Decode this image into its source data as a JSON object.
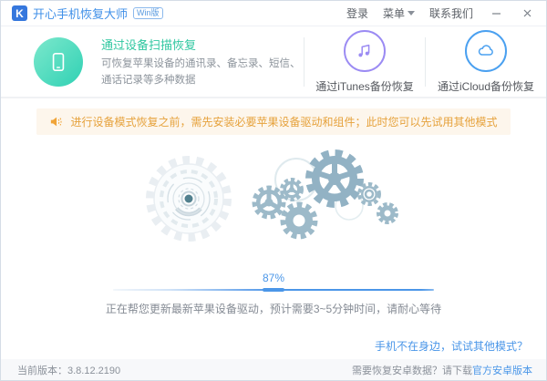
{
  "window": {
    "logo_letter": "K",
    "title": "开心手机恢复大师",
    "version_badge": "Win版",
    "menu": {
      "login": "登录",
      "menu": "菜单",
      "contact": "联系我们"
    }
  },
  "tabs": [
    {
      "title": "通过设备扫描恢复",
      "desc": "可恢复苹果设备的通讯录、备忘录、短信、通话记录等多种数据",
      "icon": "phone-icon",
      "active": true
    },
    {
      "label": "通过iTunes备份恢复",
      "icon": "music-note-icon",
      "active": false
    },
    {
      "label": "通过iCloud备份恢复",
      "icon": "cloud-icon",
      "active": false
    }
  ],
  "notice": {
    "icon": "megaphone-icon",
    "text": "进行设备模式恢复之前，需先安装必要苹果设备驱动和组件；此时您可以先试用其他模式"
  },
  "progress": {
    "percent": 87,
    "percent_label": "87%",
    "status": "正在帮您更新最新苹果设备驱动，预计需要3~5分钟时间，请耐心等待"
  },
  "links": {
    "other_mode": "手机不在身边，试试其他模式？"
  },
  "footer": {
    "version": "当前版本：3.8.12.2190",
    "android_prompt": "需要恢复安卓数据？请下载",
    "android_link": "官方安卓版本"
  },
  "colors": {
    "accent_blue": "#4a96e8",
    "green": "#2fc7a0",
    "purple": "#9b8bf3",
    "icloud_blue": "#4aa0f0",
    "warning_text": "#e6a23c",
    "warning_bg": "#fdf6ec",
    "gear": "#9dbac9"
  }
}
